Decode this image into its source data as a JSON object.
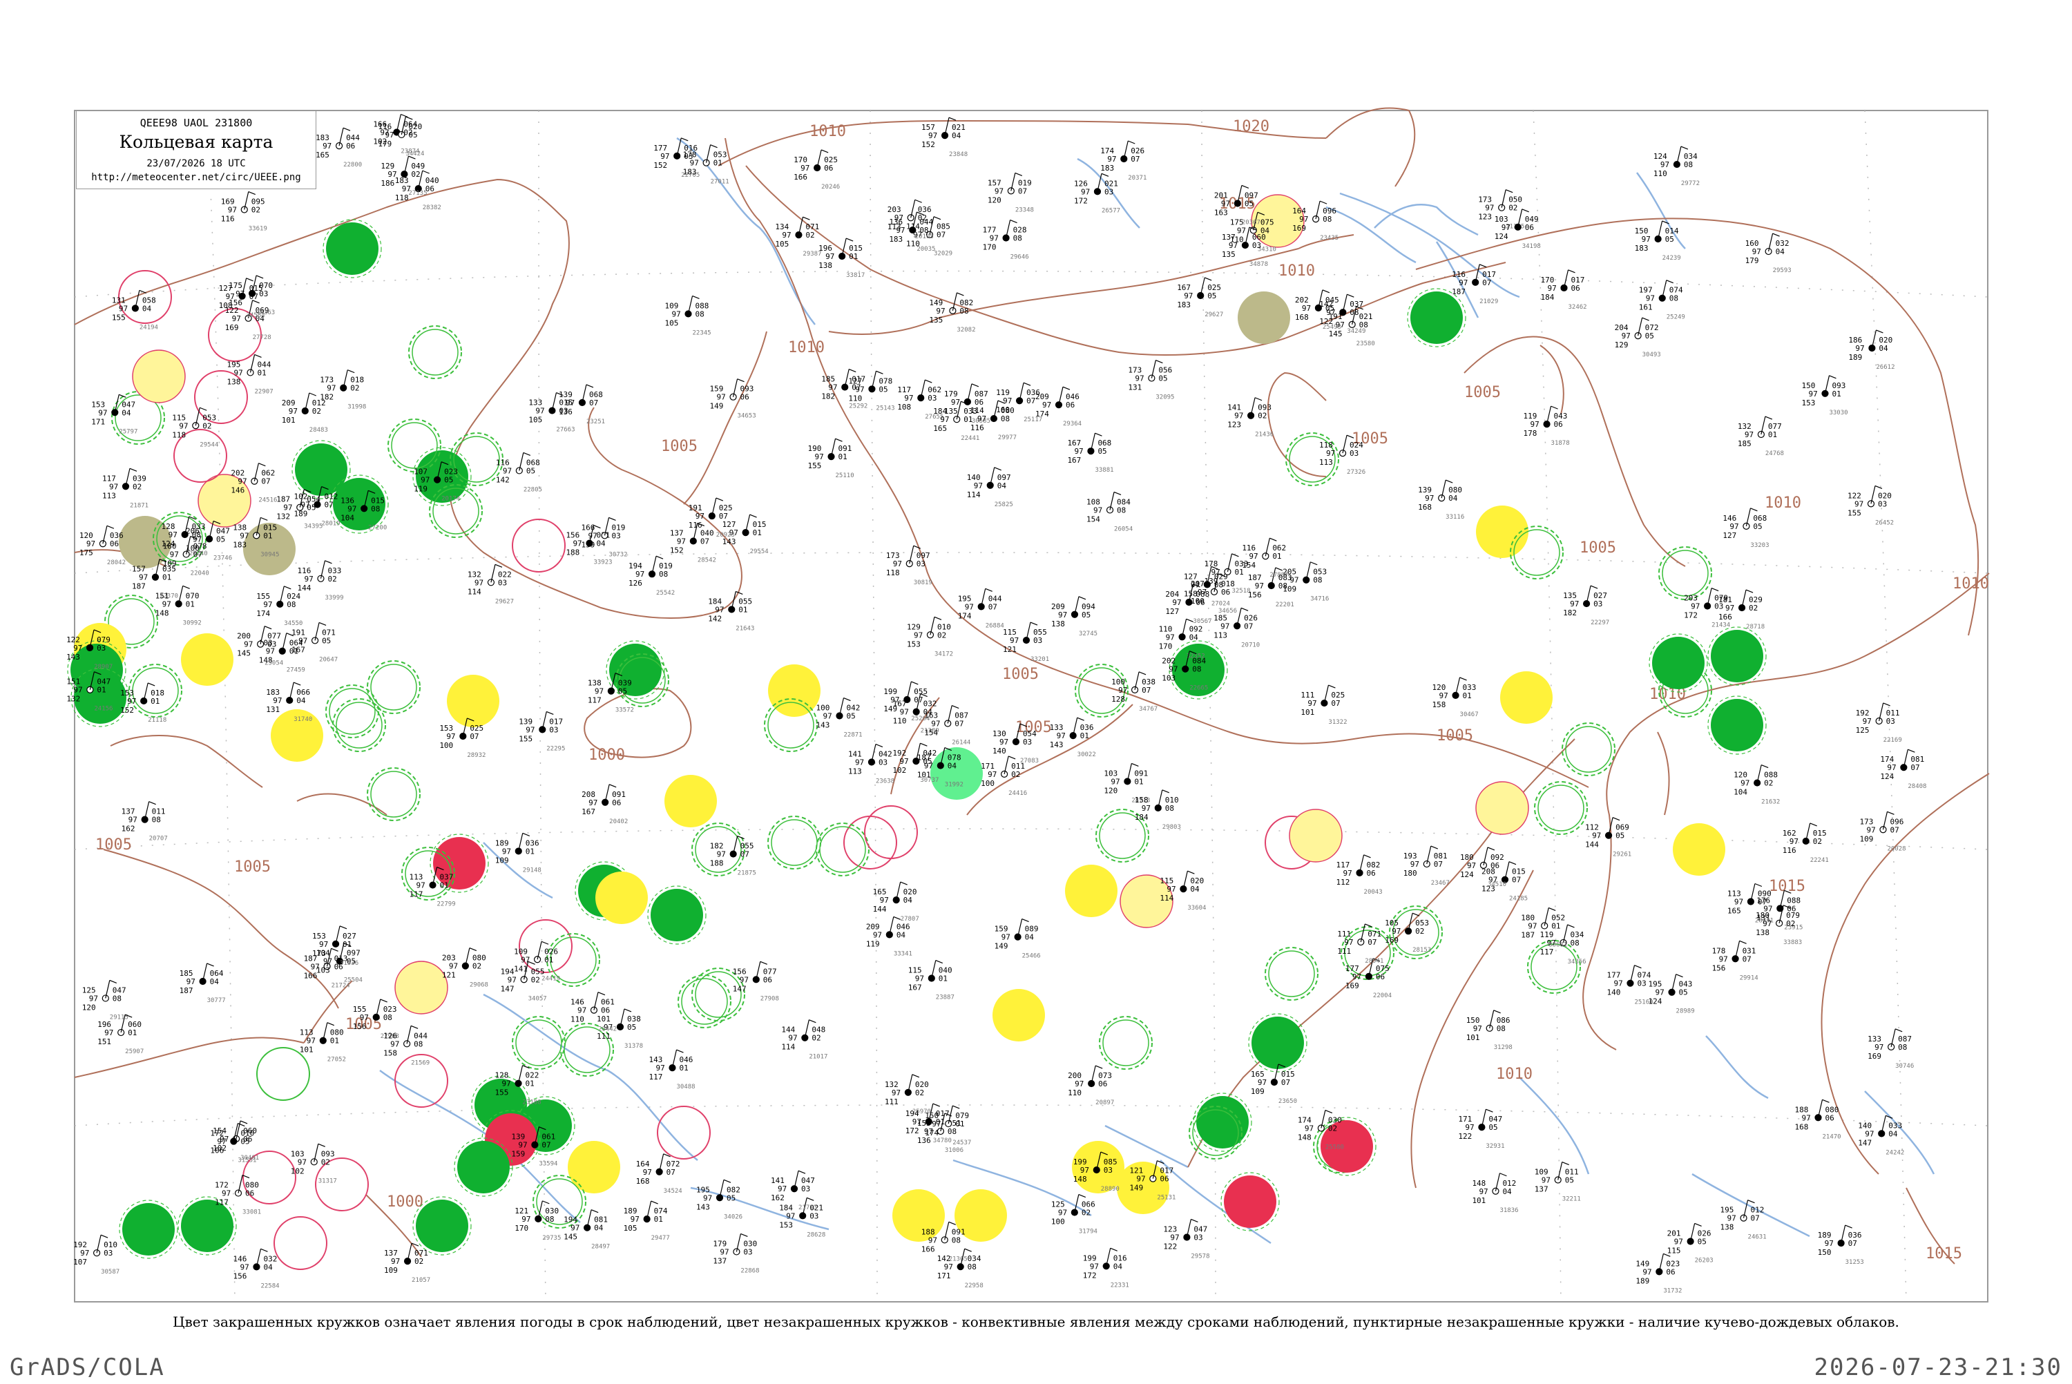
{
  "header": {
    "code_line": "QEEE98  UAOL  231800",
    "title": "Кольцевая карта",
    "datetime": "23/07/2026 18 UTC",
    "url": "http://meteocenter.net/circ/UEEE.png"
  },
  "isobars": [
    {
      "label": "1020"
    },
    {
      "label": "1015"
    },
    {
      "label": "1010"
    },
    {
      "label": "1005"
    },
    {
      "label": "1000"
    }
  ],
  "stations": [
    {
      "t": "102",
      "name": "",
      "code": "",
      "fill": "none"
    },
    {
      "t": "124",
      "p": "98",
      "name": "",
      "fill": "none"
    },
    {
      "t": "118",
      "p2": "174",
      "v": "06",
      "name": "",
      "fill": "none"
    },
    {
      "t": "82",
      "p2": "173",
      "name": "",
      "fill": "none"
    },
    {
      "t": "155",
      "p2": "079",
      "name": "",
      "fill": "none"
    },
    {
      "t": "131",
      "p2": "095",
      "name": "",
      "fill": "none"
    },
    {
      "t": "141",
      "p2": "071",
      "name": "",
      "fill": "none"
    },
    {
      "t": "72",
      "p2": "127",
      "name": "",
      "fill": "yellow"
    },
    {
      "t": "56",
      "p2": "144",
      "name": "",
      "fill": "none"
    },
    {
      "t": "209",
      "p2": "047",
      "name": "",
      "fill": "olive"
    },
    {
      "t": "111",
      "name": "",
      "fill": "green"
    },
    {
      "t": "126",
      "p2": "089",
      "name": "",
      "fill": "none"
    },
    {
      "t": "141",
      "p2": "057",
      "name": "",
      "fill": "yellow"
    },
    {
      "t": "218",
      "p2": "060",
      "name": "",
      "fill": "none"
    },
    {
      "t": "159",
      "p2": "095",
      "name": "",
      "fill": "yellow"
    },
    {
      "t": "124",
      "p2": "154",
      "name": "",
      "fill": "yellow"
    },
    {
      "t": "158",
      "p2": "021",
      "name": "",
      "fill": "yellow"
    },
    {
      "t": "137",
      "p2": "090",
      "name": "",
      "fill": "yellow"
    },
    {
      "t": "155",
      "p2": "034",
      "name": "",
      "fill": "yellow"
    },
    {
      "t": "139",
      "p2": "038",
      "name": "",
      "fill": "yellow"
    },
    {
      "t": "156",
      "p2": "021",
      "name": "",
      "fill": "yellow"
    },
    {
      "t": "135",
      "p2": "036",
      "name": "",
      "fill": "yellow"
    },
    {
      "t": "188",
      "p2": "028",
      "name": "",
      "fill": "yellow"
    },
    {
      "t": "168",
      "p2": "048",
      "name": "",
      "fill": "yellow"
    },
    {
      "t": "167",
      "p2": "052",
      "name": "",
      "fill": "yellow"
    },
    {
      "t": "158",
      "p2": "054",
      "name": "",
      "fill": "yellow"
    },
    {
      "t": "171",
      "name": "",
      "fill": "red"
    },
    {
      "t": "186",
      "p2": "050",
      "name": "",
      "fill": "yellow"
    },
    {
      "t": "181",
      "p2": "026",
      "name": "",
      "fill": "yellow"
    },
    {
      "t": "161",
      "p2": "048",
      "name": "",
      "fill": "yellow"
    },
    {
      "t": "157",
      "p2": "048",
      "name": "",
      "fill": "mint"
    },
    {
      "t": "214",
      "name": "",
      "fill": "green"
    }
  ],
  "footnote": "Цвет закрашенных кружков означает явления погоды в срок наблюдений, цвет незакрашенных кружков - конвективные явления между сроками наблюдений, пунктирные незакрашенные кружки - наличие кучево-дождевых облаков.",
  "footer": {
    "left": "GrADS/COLA",
    "right": "2026-07-23-21:30"
  },
  "colors": {
    "isobar": "#b0705a",
    "water": "#8fb4e0",
    "green": "#10b030",
    "yellow": "#fff23a",
    "red": "#e83050",
    "olive": "#bcb98a",
    "mint": "#60f090",
    "pale_yellow": "#fff59a",
    "dashed_green": "#3cbf3c",
    "dashed_red": "#e0406a"
  }
}
